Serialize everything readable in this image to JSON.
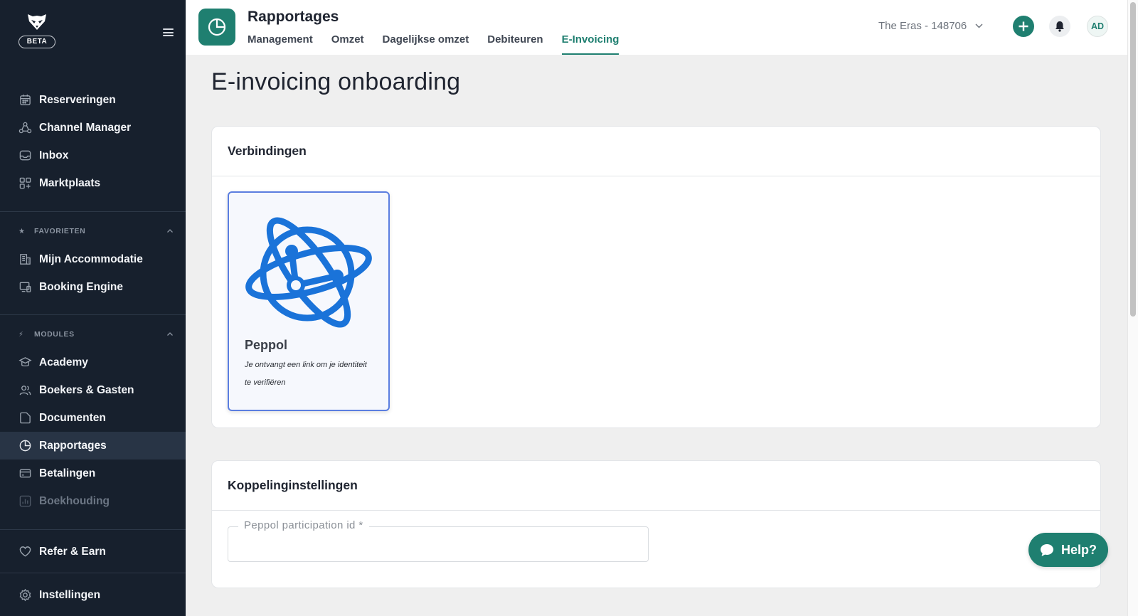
{
  "sidebar": {
    "beta_label": "BETA",
    "main_items": [
      {
        "label": "Reserveringen",
        "icon": "calendar-icon"
      },
      {
        "label": "Channel Manager",
        "icon": "channel-manager-icon"
      },
      {
        "label": "Inbox",
        "icon": "inbox-icon"
      },
      {
        "label": "Marktplaats",
        "icon": "apps-grid-icon"
      }
    ],
    "favorites": {
      "title": "FAVORIETEN",
      "items": [
        {
          "label": "Mijn Accommodatie",
          "icon": "building-icon"
        },
        {
          "label": "Booking Engine",
          "icon": "devices-icon"
        }
      ]
    },
    "modules": {
      "title": "MODULES",
      "items": [
        {
          "label": "Academy",
          "icon": "graduation-icon"
        },
        {
          "label": "Boekers & Gasten",
          "icon": "users-icon"
        },
        {
          "label": "Documenten",
          "icon": "document-icon"
        },
        {
          "label": "Rapportages",
          "icon": "pie-chart-icon"
        },
        {
          "label": "Betalingen",
          "icon": "credit-card-icon"
        },
        {
          "label": "Boekhouding",
          "icon": "bar-chart-icon"
        }
      ]
    },
    "refer_label": "Refer & Earn",
    "settings_label": "Instellingen"
  },
  "header": {
    "title": "Rapportages",
    "tabs": [
      {
        "label": "Management"
      },
      {
        "label": "Omzet"
      },
      {
        "label": "Dagelijkse omzet"
      },
      {
        "label": "Debiteuren"
      },
      {
        "label": "E-Invoicing"
      }
    ],
    "active_tab": "E-Invoicing",
    "property_selector": "The Eras - 148706",
    "avatar_initials": "AD"
  },
  "main": {
    "page_title": "E-invoicing onboarding",
    "connections_card": {
      "title": "Verbindingen",
      "tiles": [
        {
          "name": "Peppol",
          "description": "Je ontvangt een link om je identiteit te verifiëren"
        }
      ]
    },
    "settings_card": {
      "title": "Koppelinginstellingen",
      "field_label": "Peppol participation id *",
      "field_value": ""
    }
  },
  "help_button": "Help?",
  "colors": {
    "sidebar_bg": "#17202d",
    "sidebar_active": "#283445",
    "brand_teal": "#1f7f70",
    "peppol_blue": "#1a73d9",
    "tile_border": "#5b7ee0"
  }
}
